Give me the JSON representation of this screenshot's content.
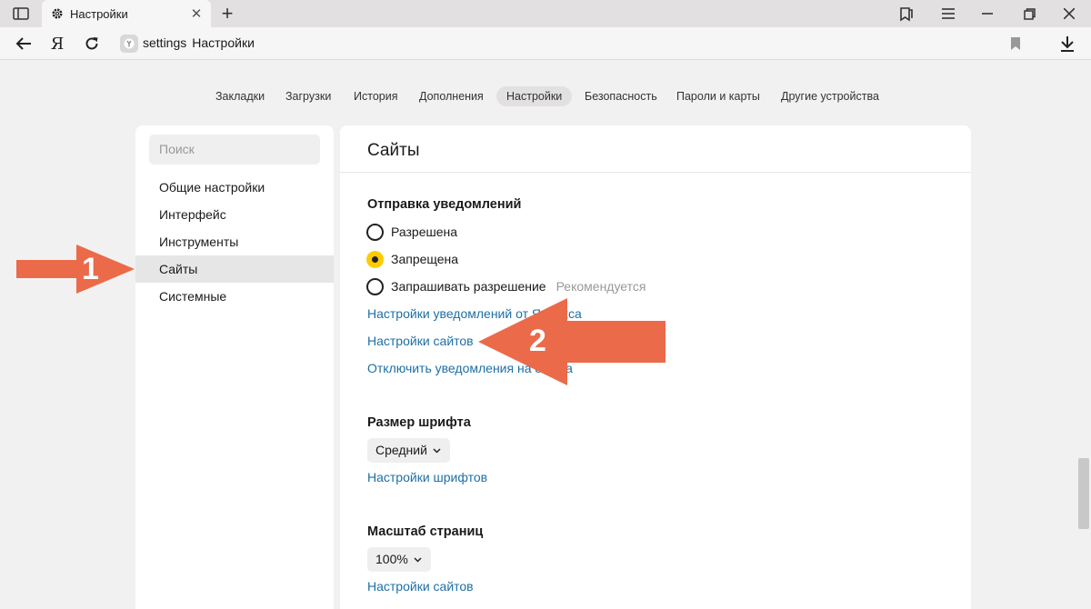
{
  "tab": {
    "title": "Настройки",
    "close_glyph": "✕"
  },
  "newtab_glyph": "+",
  "address": {
    "host": "settings",
    "page": "Настройки",
    "logo_letter": "Я"
  },
  "topnav": [
    {
      "label": "Закладки"
    },
    {
      "label": "Загрузки"
    },
    {
      "label": "История"
    },
    {
      "label": "Дополнения"
    },
    {
      "label": "Настройки",
      "active": true
    },
    {
      "label": "Безопасность"
    },
    {
      "label": "Пароли и карты"
    },
    {
      "label": "Другие устройства"
    }
  ],
  "sidebar": {
    "search_placeholder": "Поиск",
    "items": [
      {
        "label": "Общие настройки"
      },
      {
        "label": "Интерфейс"
      },
      {
        "label": "Инструменты"
      },
      {
        "label": "Сайты",
        "active": true
      },
      {
        "label": "Системные"
      }
    ]
  },
  "main": {
    "title": "Сайты",
    "notifications": {
      "title": "Отправка уведомлений",
      "options": [
        {
          "label": "Разрешена",
          "checked": false
        },
        {
          "label": "Запрещена",
          "checked": true
        },
        {
          "label": "Запрашивать разрешение",
          "checked": false,
          "hint": "Рекомендуется"
        }
      ],
      "links": [
        "Настройки уведомлений от Яндекса",
        "Настройки сайтов",
        "Отключить уведомления на 8 часа"
      ]
    },
    "font_size": {
      "title": "Размер шрифта",
      "value": "Средний",
      "link": "Настройки шрифтов"
    },
    "page_zoom": {
      "title": "Масштаб страниц",
      "value": "100%",
      "link": "Настройки сайтов"
    }
  },
  "annotations": [
    {
      "number": "1",
      "color": "#ea6a4a"
    },
    {
      "number": "2",
      "color": "#ea6a4a"
    }
  ],
  "colors": {
    "accent_link": "#1d6fa5",
    "radio_checked": "#ffcc00",
    "arrow": "#ea6a4a"
  }
}
